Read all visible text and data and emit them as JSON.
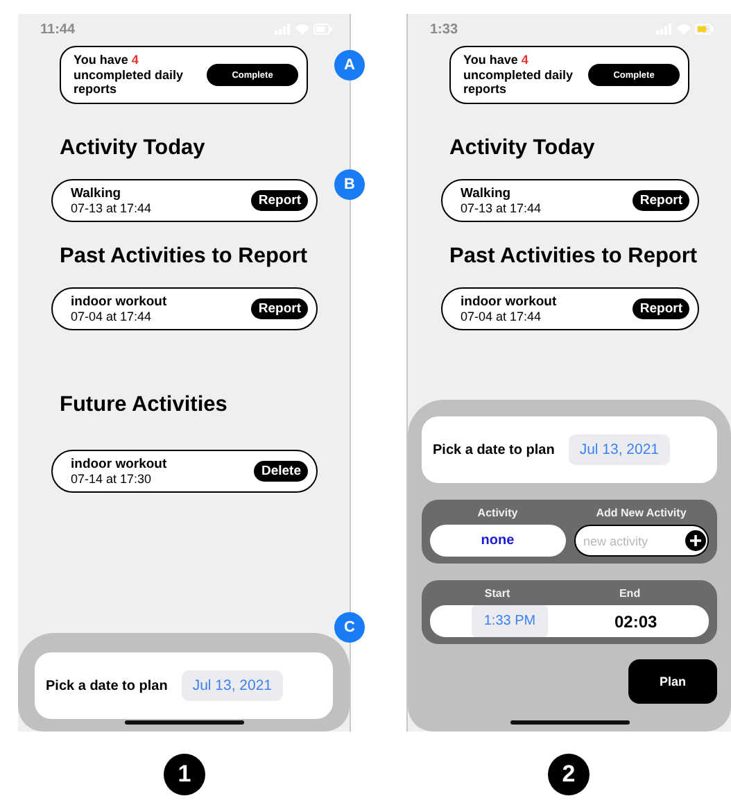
{
  "screens": [
    {
      "caption": "1",
      "status_time": "11:44",
      "charging": false,
      "banner": {
        "prefix": "You have",
        "count": "4",
        "suffix": "uncompleted daily reports",
        "button": "Complete"
      },
      "sections": [
        {
          "title": "Activity Today",
          "items": [
            {
              "name": "Walking",
              "time": "07-13 at 17:44",
              "action": "Report"
            }
          ]
        },
        {
          "title": "Past Activities to Report",
          "items": [
            {
              "name": "indoor workout",
              "time": "07-04 at 17:44",
              "action": "Report"
            }
          ]
        },
        {
          "title": "Future Activities",
          "items": [
            {
              "name": "indoor workout",
              "time": "07-14 at 17:30",
              "action": "Delete"
            }
          ]
        }
      ],
      "sheet": {
        "kind": "date",
        "date_label": "Pick a date to plan",
        "date": "Jul 13, 2021"
      }
    },
    {
      "caption": "2",
      "status_time": "1:33",
      "charging": true,
      "banner": {
        "prefix": "You have",
        "count": "4",
        "suffix": "uncompleted daily reports",
        "button": "Complete"
      },
      "sections": [
        {
          "title": "Activity Today",
          "items": [
            {
              "name": "Walking",
              "time": "07-13 at 17:44",
              "action": "Report"
            }
          ]
        },
        {
          "title": "Past Activities to Report",
          "items": [
            {
              "name": "indoor workout",
              "time": "07-04 at 17:44",
              "action": "Report"
            }
          ]
        }
      ],
      "sheet": {
        "kind": "plan",
        "date_label": "Pick a date to plan",
        "date": "Jul 13, 2021",
        "activity_label": "Activity",
        "activity_value": "none",
        "new_label": "Add New Activity",
        "new_placeholder": "new activity",
        "start_label": "Start",
        "start": "1:33 PM",
        "end_label": "End",
        "end": "02:03",
        "plan_button": "Plan"
      }
    }
  ],
  "annotations": [
    {
      "label": "A"
    },
    {
      "label": "B"
    },
    {
      "label": "C"
    }
  ]
}
